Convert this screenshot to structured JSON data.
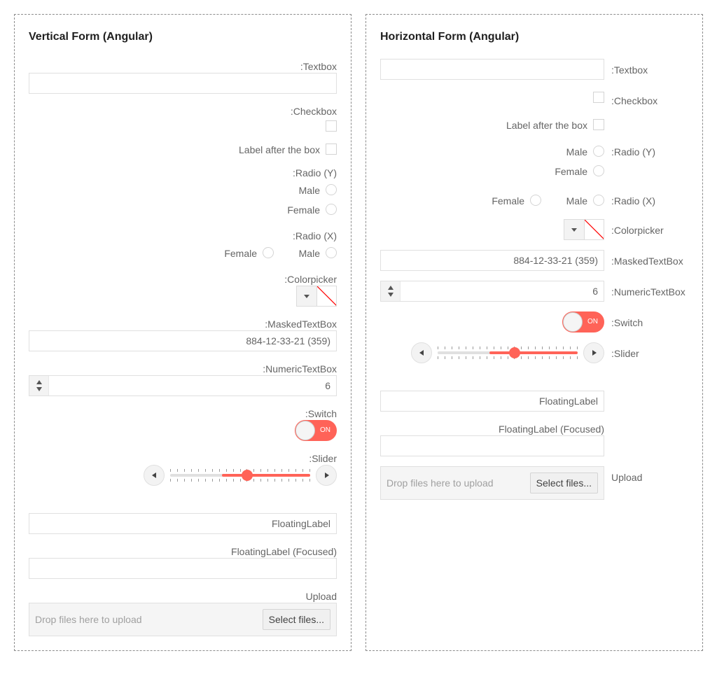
{
  "vertical": {
    "title": "Vertical Form (Angular)",
    "textbox_label": ":Textbox",
    "checkbox_label": ":Checkbox",
    "label_after_box": "Label after the box",
    "radio_y_label": ":Radio (Y)",
    "radio_y_options": [
      "Male",
      "Female"
    ],
    "radio_x_label": ":Radio (X)",
    "radio_x_options": [
      "Female",
      "Male"
    ],
    "colorpicker_label": ":Colorpicker",
    "masked_label": ":MaskedTextBox",
    "masked_value": "884-12-33-21 (359)",
    "numeric_label": ":NumericTextBox",
    "numeric_value": "6",
    "switch_label": ":Switch",
    "switch_text": "ON",
    "slider_label": ":Slider",
    "slider_value_fraction": 0.55,
    "floating_label": "FloatingLabel",
    "floating_label_focused": "FloatingLabel (Focused)",
    "upload_label": "Upload",
    "upload_hint": "Drop files here to upload",
    "upload_button": "Select files..."
  },
  "horizontal": {
    "title": "Horizontal Form (Angular)",
    "textbox_label": ":Textbox",
    "checkbox_label": ":Checkbox",
    "label_after_box": "Label after the box",
    "radio_y_label": ":Radio (Y)",
    "radio_y_options": [
      "Male",
      "Female"
    ],
    "radio_x_label": ":Radio (X)",
    "radio_x_options": [
      "Female",
      "Male"
    ],
    "colorpicker_label": ":Colorpicker",
    "masked_label": ":MaskedTextBox",
    "masked_value": "884-12-33-21 (359)",
    "numeric_label": ":NumericTextBox",
    "numeric_value": "6",
    "switch_label": ":Switch",
    "switch_text": "ON",
    "slider_label": ":Slider",
    "slider_value_fraction": 0.55,
    "floating_label": "FloatingLabel",
    "floating_label_focused": "FloatingLabel (Focused)",
    "upload_label": "Upload",
    "upload_hint": "Drop files here to upload",
    "upload_button": "Select files..."
  },
  "colors": {
    "accent": "#ff6358",
    "border": "#e0e0e0",
    "panel_border": "#8c8c8c"
  }
}
